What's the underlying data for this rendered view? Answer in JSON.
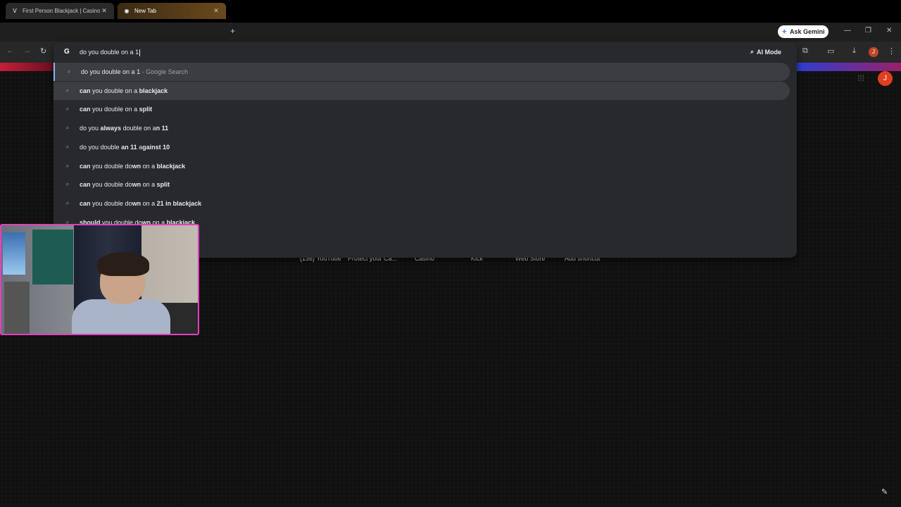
{
  "browser": {
    "tabs": [
      {
        "title": "First Person Blackjack | Casino |",
        "active": false,
        "favicon": "v-favicon"
      },
      {
        "title": "New Tab",
        "active": true,
        "favicon": "chrome-favicon"
      }
    ],
    "new_tab": "+",
    "gemini_label": "Ask Gemini",
    "window_controls": {
      "minimize": "—",
      "restore": "❐",
      "close": "✕"
    },
    "nav": {
      "back": "←",
      "forward": "→",
      "reload": "↻"
    },
    "profile_initial": "J"
  },
  "omnibox": {
    "logo": "G",
    "query": "do you double on a 1",
    "ai_mode_label": "AI Mode",
    "suggestions": [
      {
        "parts": [
          {
            "t": "do you double on a 1",
            "b": false
          },
          {
            "t": " - Google Search",
            "d": true
          }
        ]
      },
      {
        "parts": [
          {
            "t": "can",
            "b": true
          },
          {
            "t": " you double on a ",
            "b": false
          },
          {
            "t": "blackjack",
            "b": true
          }
        ]
      },
      {
        "parts": [
          {
            "t": "can",
            "b": true
          },
          {
            "t": " you double on a ",
            "b": false
          },
          {
            "t": "split",
            "b": true
          }
        ]
      },
      {
        "parts": [
          {
            "t": "do you ",
            "b": false
          },
          {
            "t": "always",
            "b": true
          },
          {
            "t": " double on a",
            "b": false
          },
          {
            "t": "n 11",
            "b": true
          }
        ]
      },
      {
        "parts": [
          {
            "t": "do you double ",
            "b": false
          },
          {
            "t": "an 11",
            "b": true
          },
          {
            "t": " a",
            "b": false
          },
          {
            "t": "gainst 10",
            "b": true
          }
        ]
      },
      {
        "parts": [
          {
            "t": "can",
            "b": true
          },
          {
            "t": " you double do",
            "b": false
          },
          {
            "t": "wn",
            "b": true
          },
          {
            "t": " on a ",
            "b": false
          },
          {
            "t": "blackjack",
            "b": true
          }
        ]
      },
      {
        "parts": [
          {
            "t": "can",
            "b": true
          },
          {
            "t": " you double do",
            "b": false
          },
          {
            "t": "wn",
            "b": true
          },
          {
            "t": " on a ",
            "b": false
          },
          {
            "t": "split",
            "b": true
          }
        ]
      },
      {
        "parts": [
          {
            "t": "can",
            "b": true
          },
          {
            "t": " you double do",
            "b": false
          },
          {
            "t": "wn",
            "b": true
          },
          {
            "t": " on a ",
            "b": false
          },
          {
            "t": "21 in blackjack",
            "b": true
          }
        ]
      },
      {
        "parts": [
          {
            "t": "should",
            "b": true
          },
          {
            "t": " you double do",
            "b": false
          },
          {
            "t": "wn",
            "b": true
          },
          {
            "t": " on a ",
            "b": false
          },
          {
            "t": "blackjack",
            "b": true
          }
        ]
      }
    ]
  },
  "newtab": {
    "avatar_initial": "J",
    "shortcuts": [
      "(136) YouTube",
      "Protect your Ca...",
      "Casino",
      "Kick",
      "Web Store",
      "Add shortcut"
    ]
  },
  "icons": {
    "search": "⌕",
    "apps": "⋮⋮",
    "edit": "✎"
  }
}
